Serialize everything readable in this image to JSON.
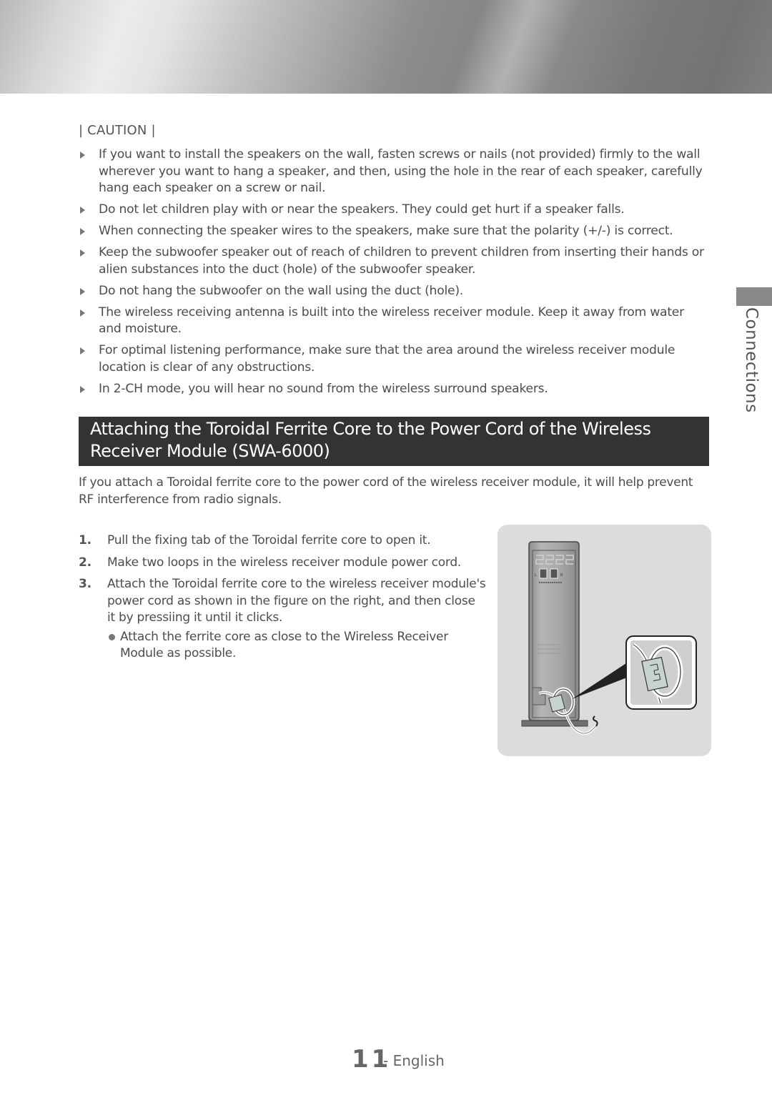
{
  "banner": {
    "icon": "metallic-header-banner"
  },
  "caution": {
    "label": "| CAUTION |",
    "items": [
      "If you want to install the speakers on the wall, fasten screws or nails (not provided) firmly to the wall wherever you want to hang a speaker, and then, using the hole in the rear of each speaker, carefully hang each speaker on a screw or nail.",
      "Do not let children play with or near the speakers. They could get hurt if a speaker falls.",
      "When connecting the speaker wires to the speakers, make sure that the polarity (+/-) is correct.",
      "Keep the subwoofer speaker out of reach of children to prevent children from inserting their hands or alien substances into the duct (hole) of the subwoofer speaker.",
      "Do not hang the subwoofer on the wall using the duct (hole).",
      "The wireless receiving antenna is built into the wireless receiver module. Keep it away from water and moisture.",
      "For optimal listening performance, make sure that the area around the wireless receiver module location is clear of any obstructions.",
      "In 2-CH mode, you will hear no sound from the wireless surround speakers."
    ]
  },
  "side_tab": {
    "label": "Connections"
  },
  "section": {
    "title": "Attaching the Toroidal Ferrite Core to the Power Cord of the Wireless Receiver Module (SWA-6000)",
    "intro": "If you attach a Toroidal ferrite core to the power cord of the wireless receiver module, it will help prevent RF interference from radio signals.",
    "steps": [
      {
        "num": "1.",
        "text": "Pull the fixing tab of the Toroidal ferrite core to open it."
      },
      {
        "num": "2.",
        "text": "Make two loops in the wireless receiver module power cord."
      },
      {
        "num": "3.",
        "text": "Attach the Toroidal ferrite core to the wireless receiver module's power cord as shown in the figure on the right, and then close it by pressiing it until it clicks."
      }
    ],
    "note": "Attach the ferrite core as close to the Wireless Receiver Module as possible."
  },
  "figure": {
    "description": "Wireless receiver module rear with ferrite core on power cord",
    "port_labels": [
      "L",
      "R"
    ]
  },
  "footer": {
    "page_number": "11",
    "language": "- English"
  }
}
